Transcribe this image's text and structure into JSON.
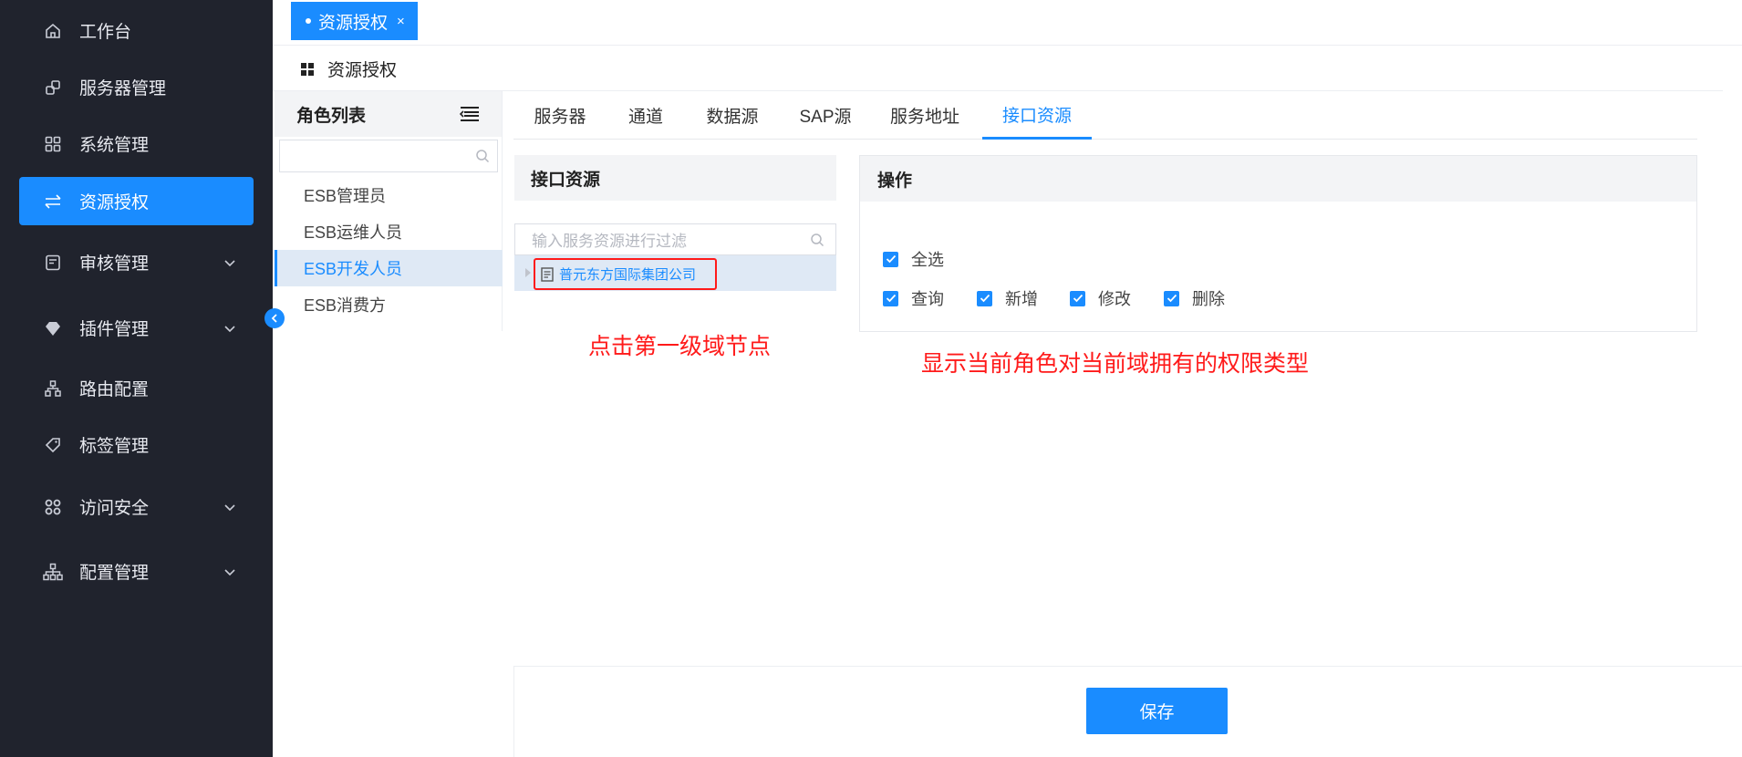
{
  "sidebar": {
    "items": [
      {
        "label": "工作台"
      },
      {
        "label": "服务器管理"
      },
      {
        "label": "系统管理"
      },
      {
        "label": "资源授权"
      },
      {
        "label": "审核管理"
      },
      {
        "label": "插件管理"
      },
      {
        "label": "路由配置"
      },
      {
        "label": "标签管理"
      },
      {
        "label": "访问安全"
      },
      {
        "label": "配置管理"
      }
    ],
    "active_item": "资源授权"
  },
  "tabbar": {
    "open_tab_label": "资源授权",
    "close_symbol": "×"
  },
  "page": {
    "title": "资源授权"
  },
  "role_list": {
    "header": "角色列表",
    "search_value": "",
    "roles": [
      "ESB管理员",
      "ESB运维人员",
      "ESB开发人员",
      "ESB消费方"
    ],
    "selected": "ESB开发人员"
  },
  "resource_tabs": {
    "tabs": [
      "服务器",
      "通道",
      "数据源",
      "SAP源",
      "服务地址",
      "接口资源"
    ],
    "active": "接口资源"
  },
  "interface_panel": {
    "header": "接口资源",
    "filter_placeholder": "输入服务资源进行过滤",
    "tree_node_label": "普元东方国际集团公司"
  },
  "operation_panel": {
    "header": "操作",
    "select_all": "全选",
    "permissions": [
      {
        "label": "查询",
        "checked": true
      },
      {
        "label": "新增",
        "checked": true
      },
      {
        "label": "修改",
        "checked": true
      },
      {
        "label": "删除",
        "checked": true
      }
    ],
    "select_all_checked": true
  },
  "annotations": {
    "left": "点击第一级域节点",
    "right": "显示当前角色对当前域拥有的权限类型"
  },
  "footer": {
    "save_label": "保存"
  },
  "colors": {
    "sidebar_bg": "#20232d",
    "accent": "#1a8cff",
    "annotation_red": "#ff1a1a",
    "selected_row_bg": "#dfe9f5"
  }
}
